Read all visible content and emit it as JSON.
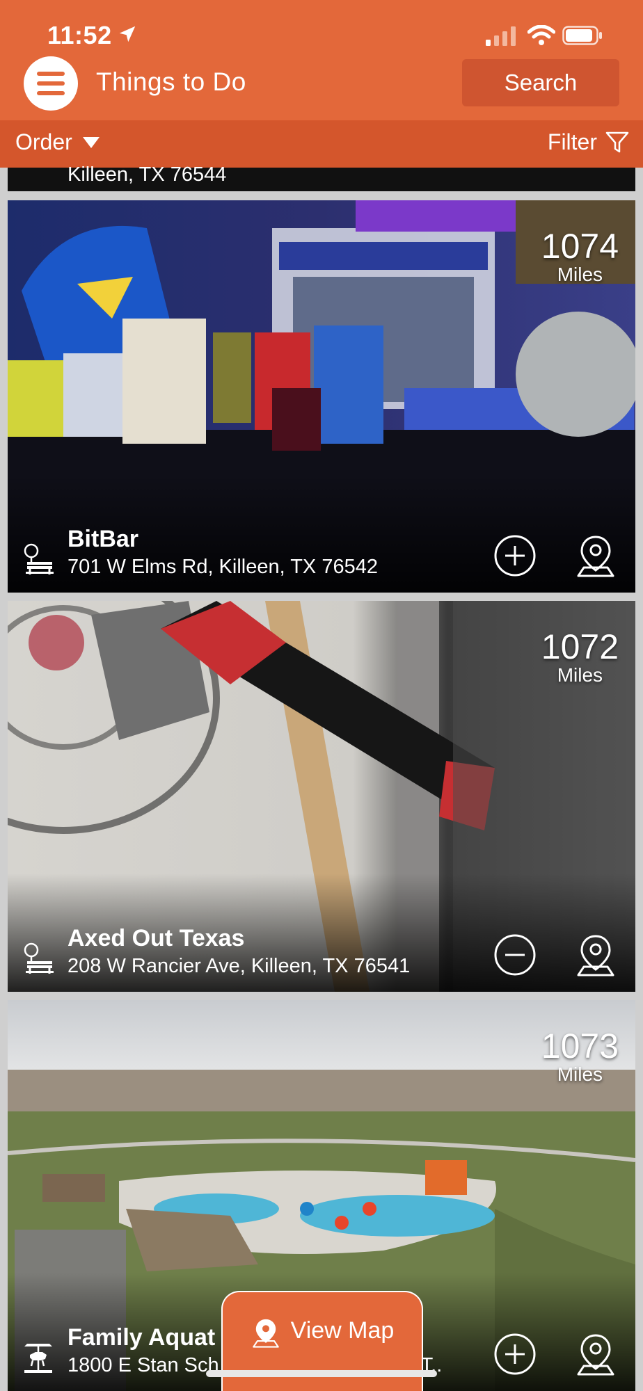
{
  "status": {
    "time": "11:52"
  },
  "header": {
    "title": "Things to Do",
    "search_label": "Search"
  },
  "toolbar": {
    "order_label": "Order",
    "filter_label": "Filter"
  },
  "partial_card": {
    "address": "Killeen, TX 76544"
  },
  "cards": [
    {
      "name": "BitBar",
      "address": "701 W Elms Rd, Killeen, TX 76542",
      "distance": "1074",
      "unit": "Miles",
      "action": "add"
    },
    {
      "name": "Axed Out Texas",
      "address": "208 W Rancier Ave, Killeen, TX 76541",
      "distance": "1072",
      "unit": "Miles",
      "action": "remove"
    },
    {
      "name": "Family Aquat",
      "address": "1800 E Stan Sch",
      "address_tail": "T..",
      "distance": "1073",
      "unit": "Miles",
      "action": "add"
    }
  ],
  "view_map_label": "View Map",
  "colors": {
    "brand": "#e3683a",
    "brand_dark": "#d4562c",
    "search_bg": "#cf5530"
  }
}
